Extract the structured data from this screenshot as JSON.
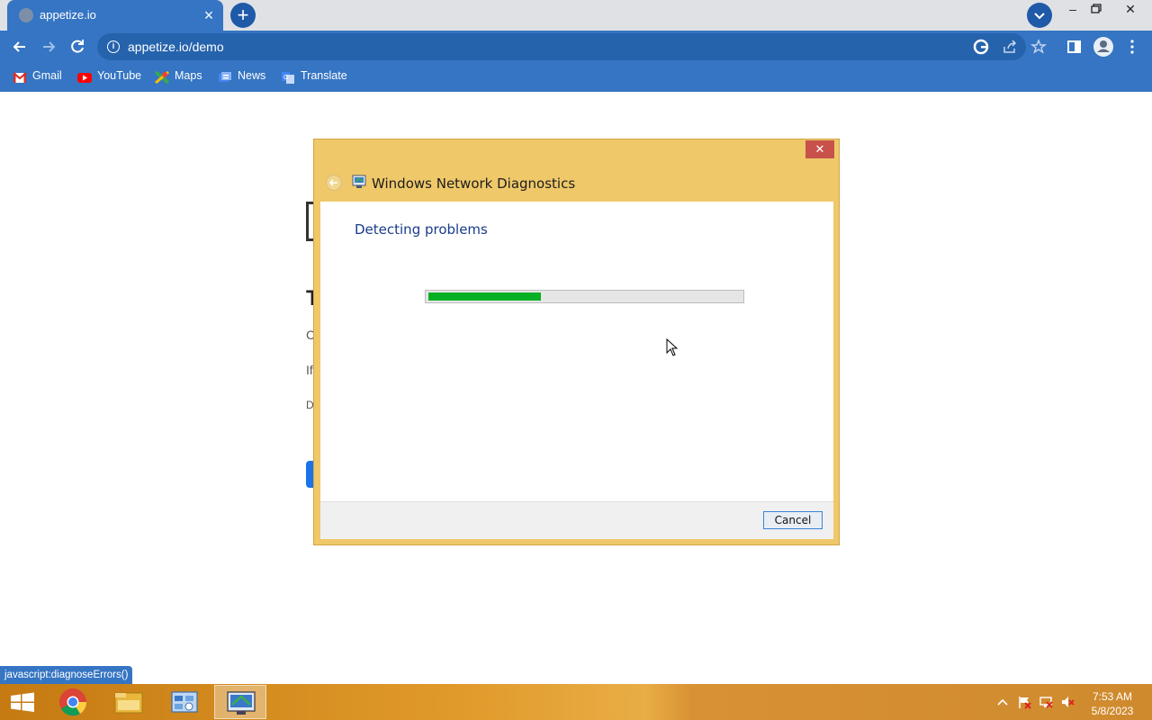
{
  "browser": {
    "tab_title": "appetize.io",
    "url": "appetize.io/demo",
    "bookmarks": [
      "Gmail",
      "YouTube",
      "Maps",
      "News",
      "Translate"
    ],
    "status_text": "javascript:diagnoseErrors()"
  },
  "page_background": {
    "fragments": [
      "T",
      "C",
      "If",
      "D"
    ]
  },
  "dialog": {
    "title": "Windows Network Diagnostics",
    "heading": "Detecting problems",
    "progress_fraction": 0.36,
    "cancel_label": "Cancel",
    "close_glyph": "✕"
  },
  "taskbar": {
    "time": "7:53 AM",
    "date": "5/8/2023"
  },
  "colors": {
    "browser_accent": "#3575c3",
    "dialog_frame": "#efc86a",
    "progress_green": "#06b025"
  }
}
